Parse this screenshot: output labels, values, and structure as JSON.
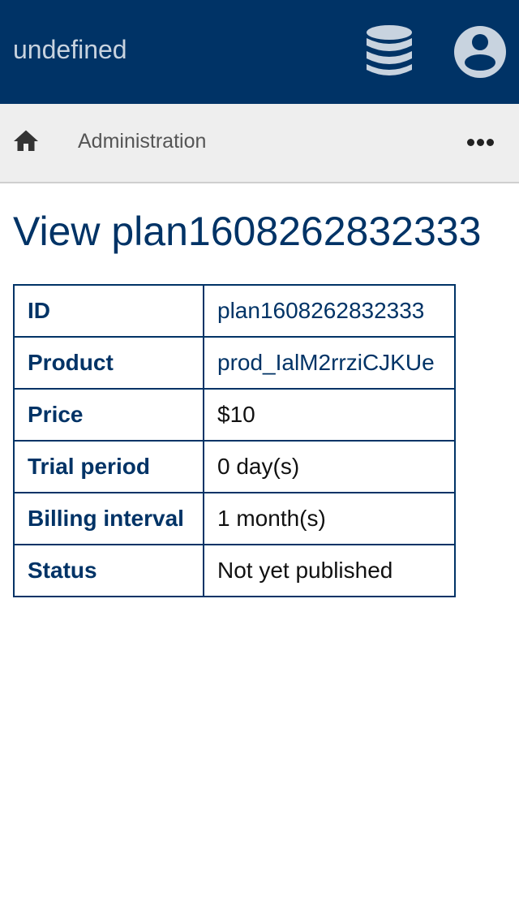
{
  "header": {
    "app_title": "undefined",
    "database_icon": "database-icon",
    "account_icon": "account-circle-icon",
    "background_color": "#003366"
  },
  "nav": {
    "home_icon": "home-icon",
    "breadcrumb_label": "Administration",
    "more_icon": "more-horizontal-icon"
  },
  "page": {
    "title": "View plan1608262832333"
  },
  "details": {
    "rows": [
      {
        "label": "ID",
        "value": "plan1608262832333"
      },
      {
        "label": "Product",
        "value": "prod_IalM2rrziCJKUe"
      },
      {
        "label": "Price",
        "value": "$10"
      },
      {
        "label": "Trial period",
        "value": "0 day(s)"
      },
      {
        "label": "Billing interval",
        "value": "1 month(s)"
      },
      {
        "label": "Status",
        "value": "Not yet published"
      }
    ]
  }
}
